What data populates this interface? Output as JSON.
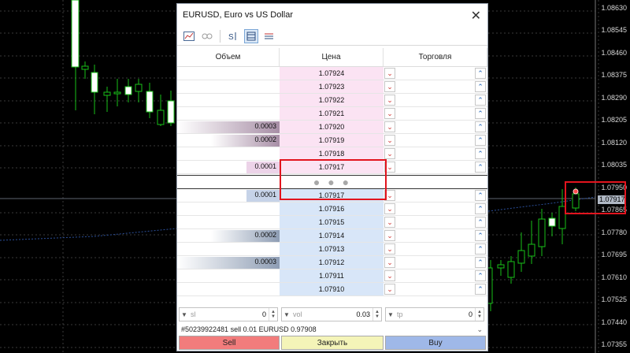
{
  "price_axis": [
    "1.08630",
    "1.08545",
    "1.08460",
    "1.08375",
    "1.08290",
    "1.08205",
    "1.08120",
    "1.08035",
    "1.07950",
    "1.07865",
    "1.07780",
    "1.07695",
    "1.07610",
    "1.07525",
    "1.07440",
    "1.07355"
  ],
  "current_price_tag": "1.07917",
  "dialog": {
    "title": "EURUSD, Euro vs US Dollar",
    "close_glyph": "✕",
    "columns": {
      "volume": "Объем",
      "price": "Цена",
      "trade": "Торговля"
    },
    "asks": [
      {
        "price": "1.07924",
        "volume": ""
      },
      {
        "price": "1.07923",
        "volume": ""
      },
      {
        "price": "1.07922",
        "volume": ""
      },
      {
        "price": "1.07921",
        "volume": ""
      },
      {
        "price": "1.07920",
        "volume": "0.0003"
      },
      {
        "price": "1.07919",
        "volume": "0.0002"
      },
      {
        "price": "1.07918",
        "volume": ""
      },
      {
        "price": "1.07917",
        "volume": "0.0001"
      }
    ],
    "bids": [
      {
        "price": "1.07917",
        "volume": "0.0001"
      },
      {
        "price": "1.07916",
        "volume": ""
      },
      {
        "price": "1.07915",
        "volume": ""
      },
      {
        "price": "1.07914",
        "volume": "0.0002"
      },
      {
        "price": "1.07913",
        "volume": ""
      },
      {
        "price": "1.07912",
        "volume": "0.0003"
      },
      {
        "price": "1.07911",
        "volume": ""
      },
      {
        "price": "1.07910",
        "volume": ""
      }
    ],
    "spread_dots": "● ● ●",
    "fields": {
      "sl": {
        "placeholder": "sl",
        "value": "0"
      },
      "vol": {
        "placeholder": "vol",
        "value": "0.03"
      },
      "tp": {
        "placeholder": "tp",
        "value": "0"
      }
    },
    "order_line": "#50239922481 sell 0.01 EURUSD 0.97908",
    "buttons": {
      "sell": "Sell",
      "close": "Закрыть",
      "buy": "Buy"
    }
  },
  "colors": {
    "sell": "#f27c7c",
    "close": "#f4f4b8",
    "buy": "#9fb8e8",
    "highlight": "#e2141e"
  }
}
